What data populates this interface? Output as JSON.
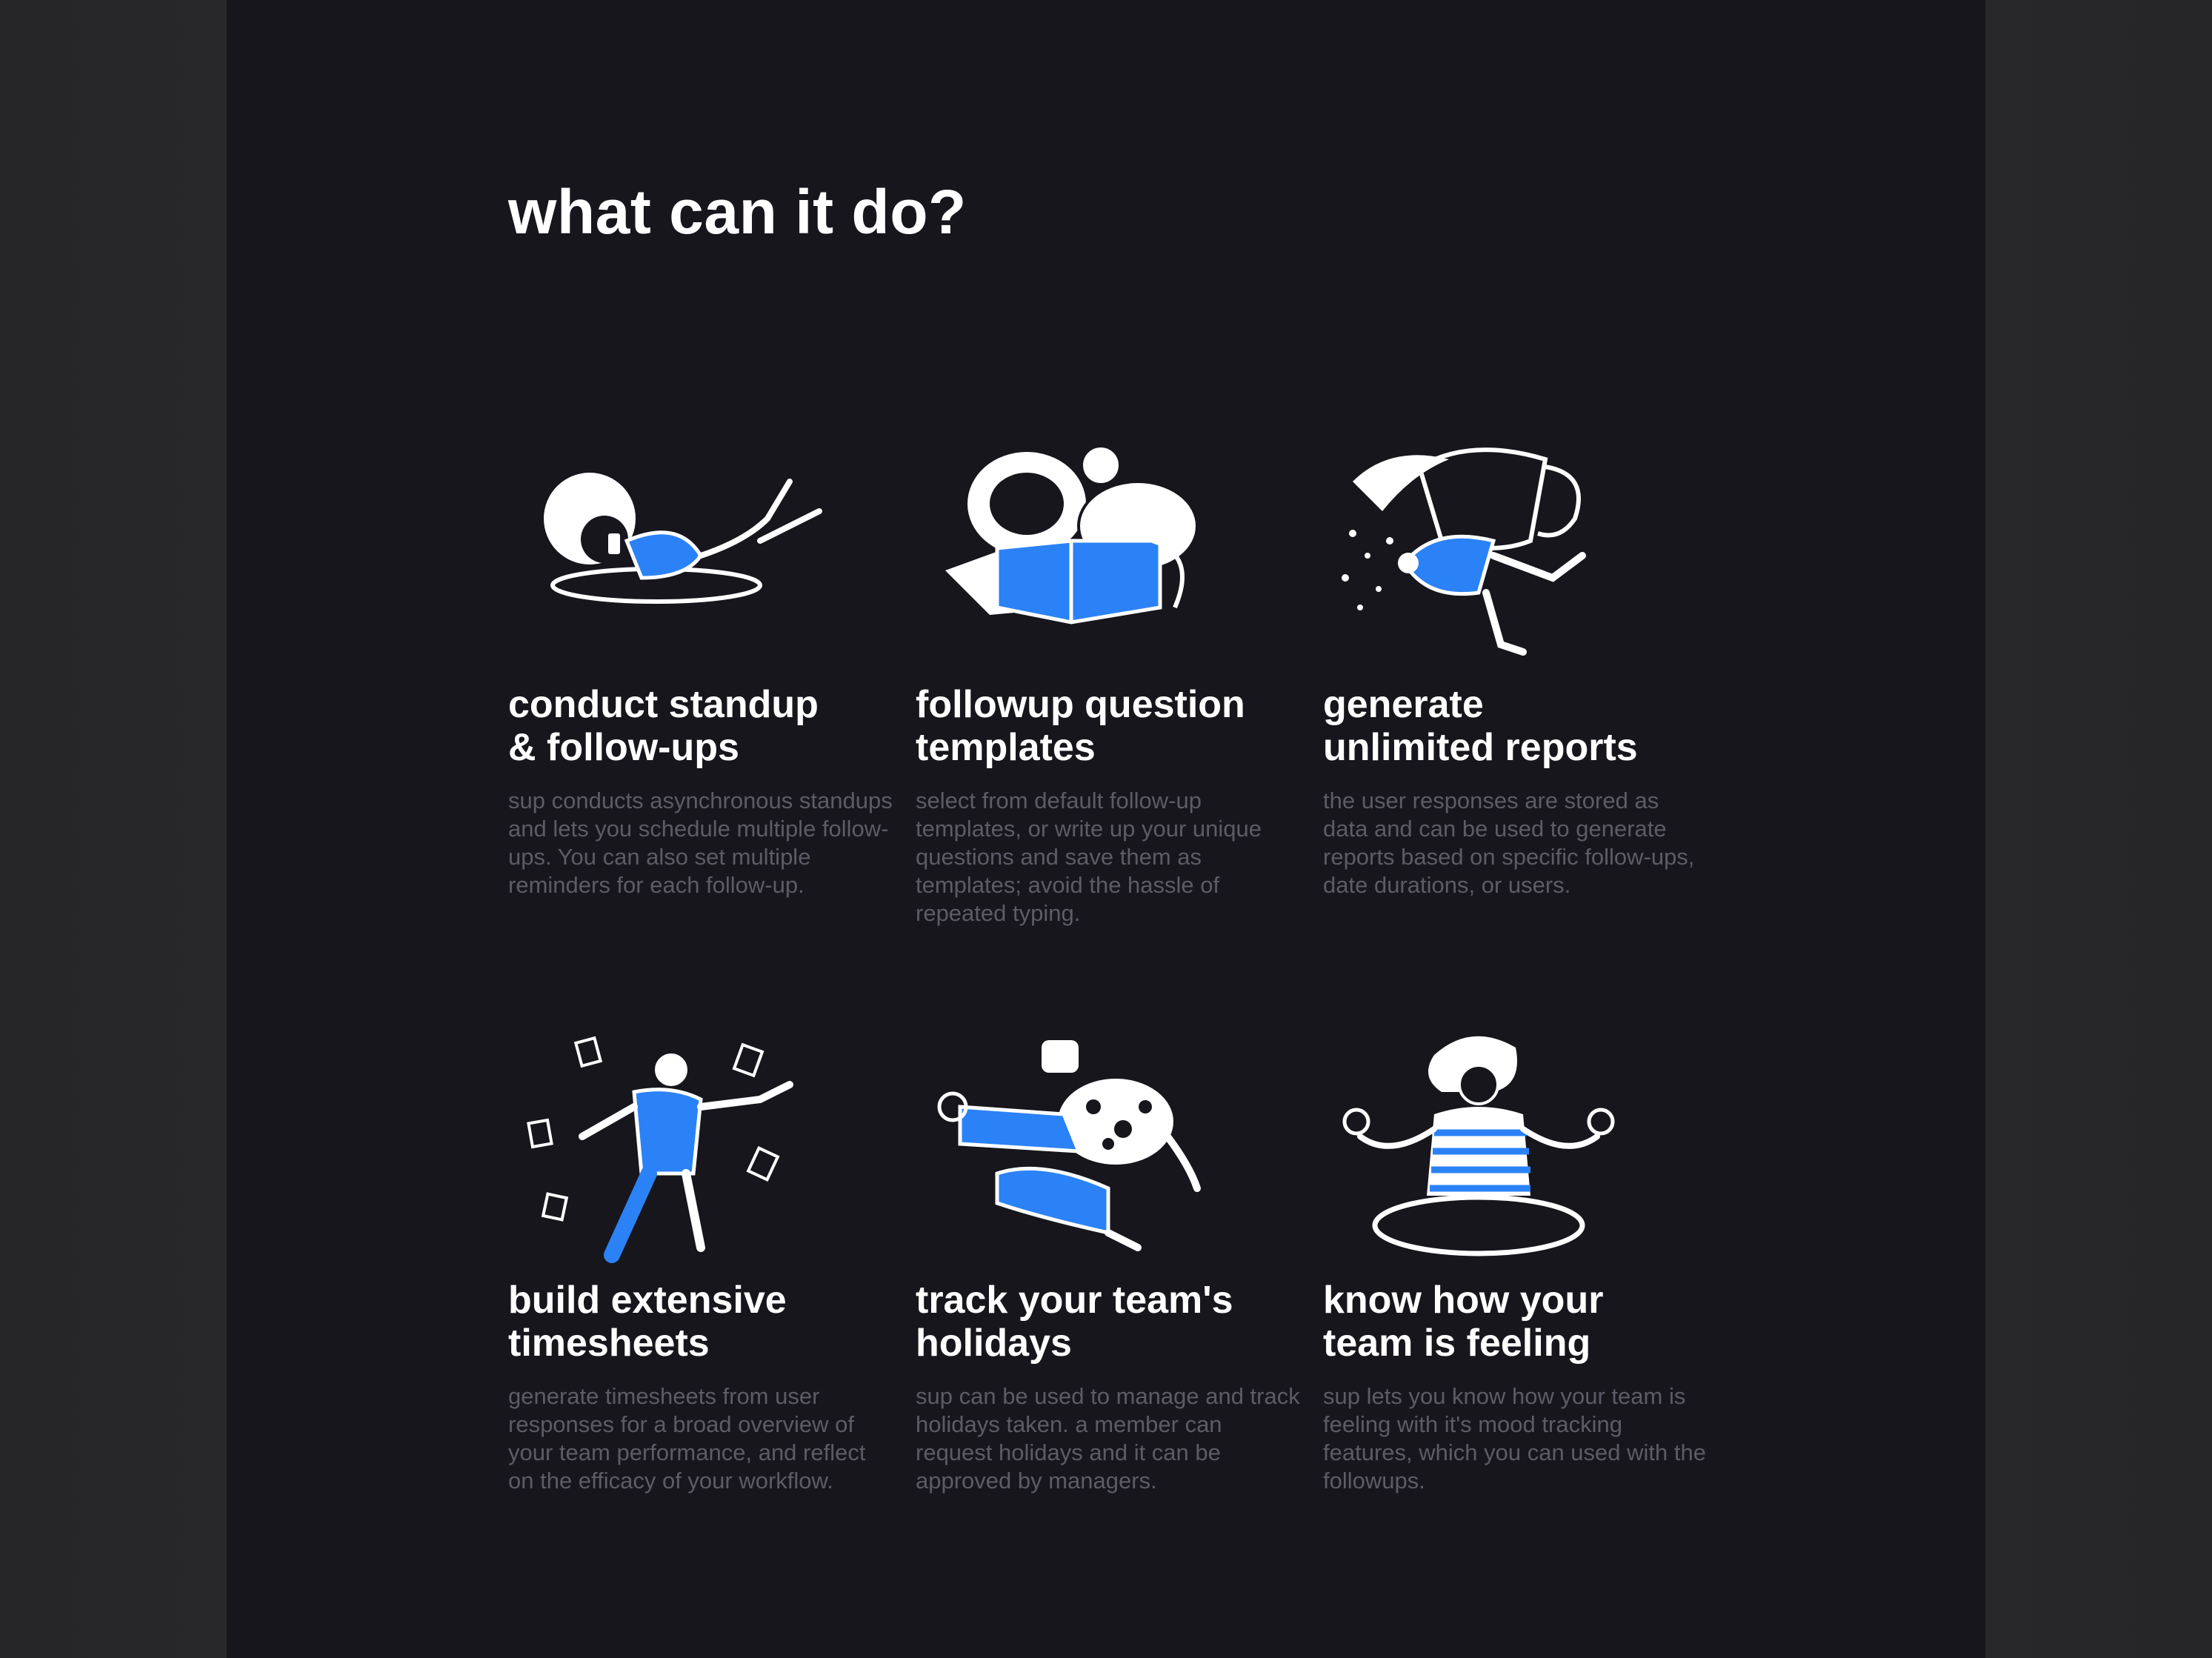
{
  "title": "what can it do?",
  "colors": {
    "accent": "#2b82f6",
    "background": "#17161d",
    "heading": "#ffffff",
    "body_text": "#5d5c66"
  },
  "features": [
    {
      "title_lines": [
        "conduct standup",
        "& follow-ups"
      ],
      "description": "sup conducts asynchronous standups and lets you schedule multiple follow-ups. You can also set multiple reminders for each follow-up.",
      "icon": "person-lying-with-phone-illustration"
    },
    {
      "title_lines": [
        "followup question",
        "templates"
      ],
      "description": "select from default follow-up templates, or write up your unique questions and save them as templates; avoid the hassle of repeated typing.",
      "icon": "person-with-box-illustration"
    },
    {
      "title_lines": [
        "generate",
        "unlimited reports"
      ],
      "description": "the user responses are stored as data and can be used to generate reports based on specific follow-ups, date durations, or users.",
      "icon": "person-with-mug-illustration"
    },
    {
      "title_lines": [
        "build extensive",
        "timesheets"
      ],
      "description": "generate timesheets from user responses for a broad overview of your team performance, and reflect on the efficacy of your workflow.",
      "icon": "person-juggling-papers-illustration"
    },
    {
      "title_lines": [
        "track your team's",
        "holidays"
      ],
      "description": "sup can be used to manage and track holidays taken. a member can request holidays and it can be approved by managers.",
      "icon": "person-jumping-illustration"
    },
    {
      "title_lines": [
        "know how your",
        "team is feeling"
      ],
      "description": "sup lets you know how your team is feeling with it's mood tracking features, which you can used with the followups.",
      "icon": "person-meditating-illustration"
    }
  ]
}
